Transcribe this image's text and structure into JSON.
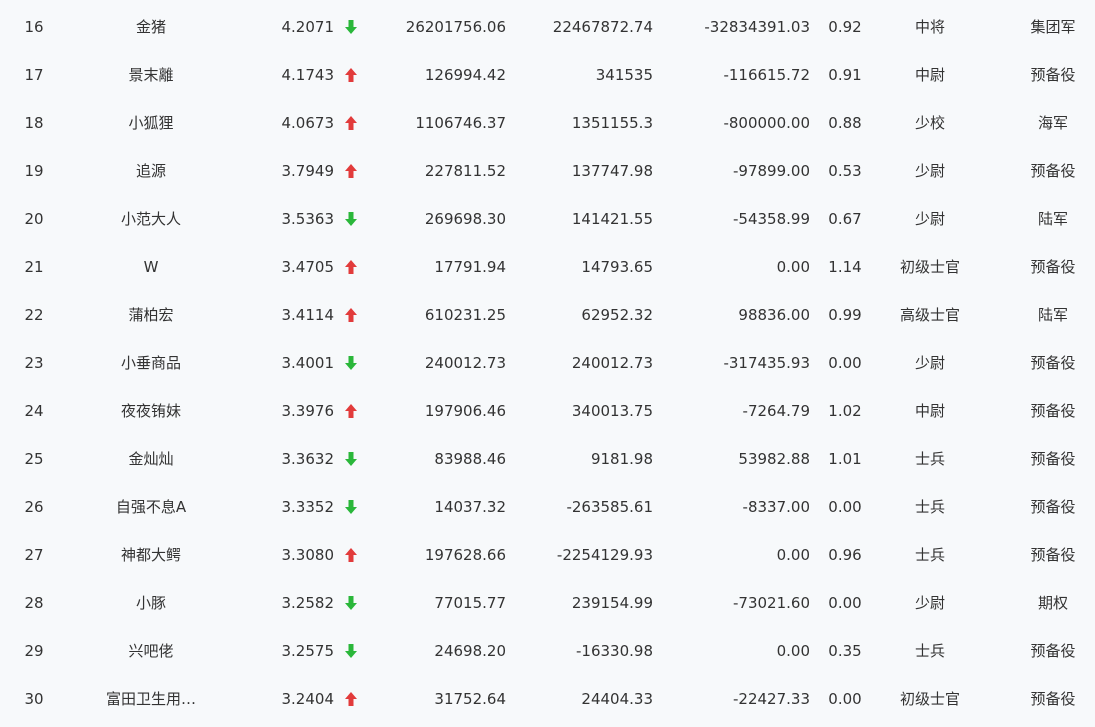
{
  "colors": {
    "background": "#f7f9fb",
    "text": "#333333",
    "up": "#e23b3b",
    "down": "#2ab73a"
  },
  "icons": {
    "up": "arrow-up-icon",
    "down": "arrow-down-icon"
  },
  "rows": [
    {
      "rank": "16",
      "name": "金猪",
      "score": "4.2071",
      "trend": "down",
      "v1": "26201756.06",
      "v2": "22467872.74",
      "v3": "-32834391.03",
      "ratio": "0.92",
      "title": "中将",
      "army": "集团军"
    },
    {
      "rank": "17",
      "name": "景末離",
      "score": "4.1743",
      "trend": "up",
      "v1": "126994.42",
      "v2": "341535",
      "v3": "-116615.72",
      "ratio": "0.91",
      "title": "中尉",
      "army": "预备役"
    },
    {
      "rank": "18",
      "name": "小狐狸",
      "score": "4.0673",
      "trend": "up",
      "v1": "1106746.37",
      "v2": "1351155.3",
      "v3": "-800000.00",
      "ratio": "0.88",
      "title": "少校",
      "army": "海军"
    },
    {
      "rank": "19",
      "name": "追源",
      "score": "3.7949",
      "trend": "up",
      "v1": "227811.52",
      "v2": "137747.98",
      "v3": "-97899.00",
      "ratio": "0.53",
      "title": "少尉",
      "army": "预备役"
    },
    {
      "rank": "20",
      "name": "小范大人",
      "score": "3.5363",
      "trend": "down",
      "v1": "269698.30",
      "v2": "141421.55",
      "v3": "-54358.99",
      "ratio": "0.67",
      "title": "少尉",
      "army": "陆军"
    },
    {
      "rank": "21",
      "name": "W",
      "score": "3.4705",
      "trend": "up",
      "v1": "17791.94",
      "v2": "14793.65",
      "v3": "0.00",
      "ratio": "1.14",
      "title": "初级士官",
      "army": "预备役"
    },
    {
      "rank": "22",
      "name": "蒲柏宏",
      "score": "3.4114",
      "trend": "up",
      "v1": "610231.25",
      "v2": "62952.32",
      "v3": "98836.00",
      "ratio": "0.99",
      "title": "高级士官",
      "army": "陆军"
    },
    {
      "rank": "23",
      "name": "小垂商品",
      "score": "3.4001",
      "trend": "down",
      "v1": "240012.73",
      "v2": "240012.73",
      "v3": "-317435.93",
      "ratio": "0.00",
      "title": "少尉",
      "army": "预备役"
    },
    {
      "rank": "24",
      "name": "夜夜铕妹",
      "score": "3.3976",
      "trend": "up",
      "v1": "197906.46",
      "v2": "340013.75",
      "v3": "-7264.79",
      "ratio": "1.02",
      "title": "中尉",
      "army": "预备役"
    },
    {
      "rank": "25",
      "name": "金灿灿",
      "score": "3.3632",
      "trend": "down",
      "v1": "83988.46",
      "v2": "9181.98",
      "v3": "53982.88",
      "ratio": "1.01",
      "title": "士兵",
      "army": "预备役"
    },
    {
      "rank": "26",
      "name": "自强不息A",
      "score": "3.3352",
      "trend": "down",
      "v1": "14037.32",
      "v2": "-263585.61",
      "v3": "-8337.00",
      "ratio": "0.00",
      "title": "士兵",
      "army": "预备役"
    },
    {
      "rank": "27",
      "name": "神都大鳄",
      "score": "3.3080",
      "trend": "up",
      "v1": "197628.66",
      "v2": "-2254129.93",
      "v3": "0.00",
      "ratio": "0.96",
      "title": "士兵",
      "army": "预备役"
    },
    {
      "rank": "28",
      "name": "小豚",
      "score": "3.2582",
      "trend": "down",
      "v1": "77015.77",
      "v2": "239154.99",
      "v3": "-73021.60",
      "ratio": "0.00",
      "title": "少尉",
      "army": "期权"
    },
    {
      "rank": "29",
      "name": "兴吧佬",
      "score": "3.2575",
      "trend": "down",
      "v1": "24698.20",
      "v2": "-16330.98",
      "v3": "0.00",
      "ratio": "0.35",
      "title": "士兵",
      "army": "预备役"
    },
    {
      "rank": "30",
      "name": "富田卫生用…",
      "score": "3.2404",
      "trend": "up",
      "v1": "31752.64",
      "v2": "24404.33",
      "v3": "-22427.33",
      "ratio": "0.00",
      "title": "初级士官",
      "army": "预备役"
    }
  ]
}
